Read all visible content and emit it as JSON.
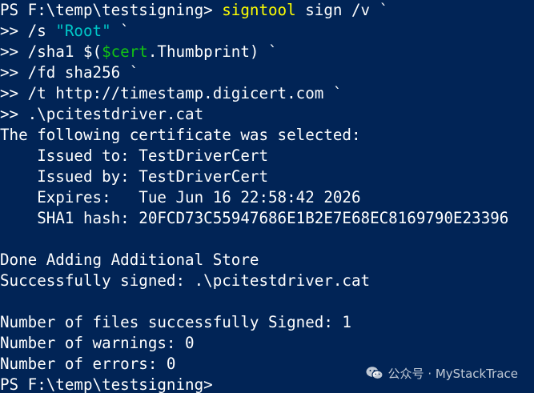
{
  "prompt": {
    "ps_prefix": "PS F:\\temp\\testsigning> ",
    "continuation": ">> "
  },
  "command": {
    "name": "signtool",
    "args": " sign /v `",
    "line2_a": "/s ",
    "line2_str": "\"Root\"",
    "line2_b": " `",
    "line3_a": "/sha1 $(",
    "line3_var": "$cert",
    "line3_b": ".Thumbprint) `",
    "line4": "/fd sha256 `",
    "line5": "/t http://timestamp.digicert.com `",
    "line6": ".\\pcitestdriver.cat"
  },
  "output": {
    "cert_selected": "The following certificate was selected:",
    "issued_to": "    Issued to: TestDriverCert",
    "issued_by": "    Issued by: TestDriverCert",
    "expires": "    Expires:   Tue Jun 16 22:58:42 2026",
    "sha1": "    SHA1 hash: 20FCD73C55947686E1B2E7E68EC8169790E23396",
    "done_store": "Done Adding Additional Store",
    "signed": "Successfully signed: .\\pcitestdriver.cat",
    "num_signed": "Number of files successfully Signed: 1",
    "num_warnings": "Number of warnings: 0",
    "num_errors": "Number of errors: 0",
    "final_prompt": "PS F:\\temp\\testsigning>"
  },
  "watermark": {
    "text": "公众号 · MyStackTrace",
    "icon": "wechat-icon"
  },
  "colors": {
    "background": "#012456",
    "text": "#ffffff",
    "command": "#ffff00",
    "string": "#00c8c8",
    "variable": "#13c313"
  }
}
